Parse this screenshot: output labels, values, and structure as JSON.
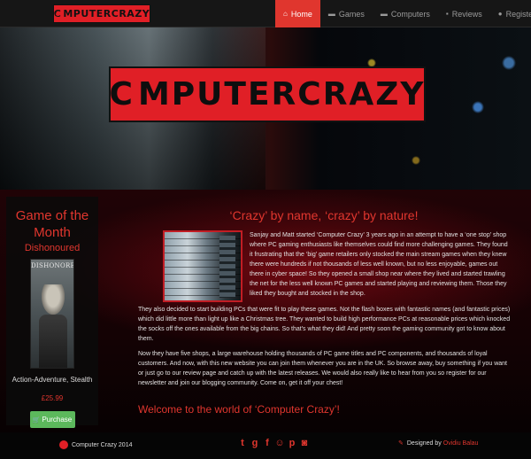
{
  "nav": {
    "brand": "COMPUTERCRAZY",
    "items": [
      {
        "label": "Home",
        "icon": "home-icon",
        "glyph": "⌂"
      },
      {
        "label": "Games",
        "icon": "gamepad-icon",
        "glyph": "▬"
      },
      {
        "label": "Computers",
        "icon": "computer-icon",
        "glyph": "▬"
      },
      {
        "label": "Reviews",
        "icon": "comment-icon",
        "glyph": "▪"
      },
      {
        "label": "Register",
        "icon": "user-icon",
        "glyph": "●"
      }
    ]
  },
  "hero": {
    "banner": "COMPUTERCRAZY"
  },
  "sidebar": {
    "title": "Game of the Month",
    "game_name": "Dishonoured",
    "cover_title": "DISHONORED",
    "genre": "Action-Adventure, Stealth",
    "price": "£25.99",
    "buy_label": "Purchase"
  },
  "content": {
    "title": "‘Crazy’ by name, ‘crazy’ by nature!",
    "paragraphs": [
      "Sanjay and Matt started ‘Computer Crazy’ 3 years ago in an attempt to have a ‘one stop’ shop where PC gaming enthusiasts like themselves could find more challenging games. They found it frustrating that the ‘big’ game retailers only stocked the main stream games when they knew there were hundreds if not thousands of less well known, but no less enjoyable, games out there in cyber space! So they opened a small shop near where they lived and started trawling the net for the less well known PC games and started playing and reviewing them. Those they liked they bought and stocked in the shop.",
      "They also decided to start building PCs that were fit to play these games. Not the flash boxes with fantastic names (and fantastic prices) which did little more than light up like a Christmas tree. They wanted to build high performance PCs at reasonable prices which knocked the socks off the ones available from the big chains. So that's what they did! And pretty soon the gaming community got to know about them.",
      "Now they have five shops, a large warehouse holding thousands of PC game titles and PC components, and thousands of loyal customers. And now, with this new website you can join them whenever you are in the UK. So browse away, buy something if you want or just go to our review page and catch up with the latest releases. We would also really like to hear from you so register for our newsletter and join our blogging community. Come on, get it off your chest!"
    ],
    "welcome": "Welcome to the world of ‘Computer Crazy’!"
  },
  "footer": {
    "copyright": "Computer Crazy 2014",
    "social": [
      {
        "icon": "twitter-icon",
        "glyph": "t"
      },
      {
        "icon": "google-plus-icon",
        "glyph": "g"
      },
      {
        "icon": "facebook-icon",
        "glyph": "f"
      },
      {
        "icon": "reddit-icon",
        "glyph": "☺"
      },
      {
        "icon": "pinterest-icon",
        "glyph": "p"
      },
      {
        "icon": "instagram-icon",
        "glyph": "◙"
      }
    ],
    "designed_by": "Designed by",
    "author": "Ovidiu Balau"
  },
  "colors": {
    "accent": "#e0362e",
    "logo_red": "#e01f26",
    "buy_green": "#5cb85c"
  }
}
